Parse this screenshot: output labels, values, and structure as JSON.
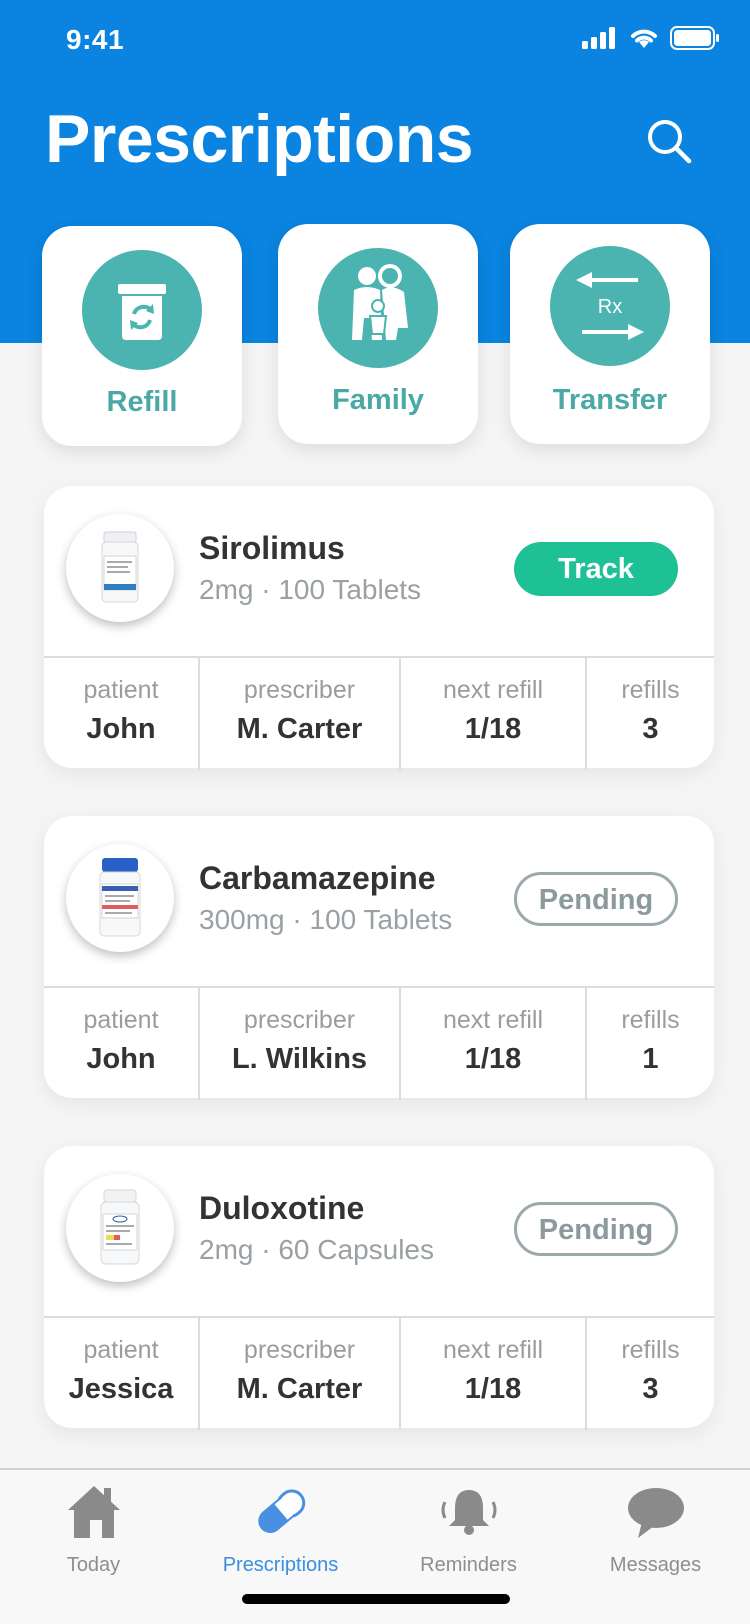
{
  "status_bar": {
    "time": "9:41"
  },
  "header": {
    "title": "Prescriptions",
    "search_icon": "search-icon"
  },
  "quick_actions": [
    {
      "label": "Refill",
      "icon": "refill-icon"
    },
    {
      "label": "Family",
      "icon": "family-icon"
    },
    {
      "label": "Transfer",
      "icon": "transfer-icon",
      "icon_text": "Rx"
    }
  ],
  "colors": {
    "header": "#0a84e0",
    "accent_teal": "#4bb3b0",
    "track_green": "#1ec195",
    "active_tab": "#3a8ee0"
  },
  "detail_labels": {
    "patient": "patient",
    "prescriber": "prescriber",
    "next_refill": "next refill",
    "refills": "refills"
  },
  "prescriptions": [
    {
      "name": "Sirolimus",
      "dose": "2mg · 100 Tablets",
      "status": "Track",
      "patient": "John",
      "prescriber": "M. Carter",
      "next_refill": "1/18",
      "refills": "3"
    },
    {
      "name": "Carbamazepine",
      "dose": "300mg · 100 Tablets",
      "status": "Pending",
      "patient": "John",
      "prescriber": "L. Wilkins",
      "next_refill": "1/18",
      "refills": "1"
    },
    {
      "name": "Duloxotine",
      "dose": "2mg · 60 Capsules",
      "status": "Pending",
      "patient": "Jessica",
      "prescriber": "M. Carter",
      "next_refill": "1/18",
      "refills": "3"
    }
  ],
  "tabbar": [
    {
      "label": "Today",
      "icon": "house-icon"
    },
    {
      "label": "Prescriptions",
      "icon": "pill-icon",
      "active": true
    },
    {
      "label": "Reminders",
      "icon": "bell-icon"
    },
    {
      "label": "Messages",
      "icon": "speech-bubble-icon"
    }
  ]
}
